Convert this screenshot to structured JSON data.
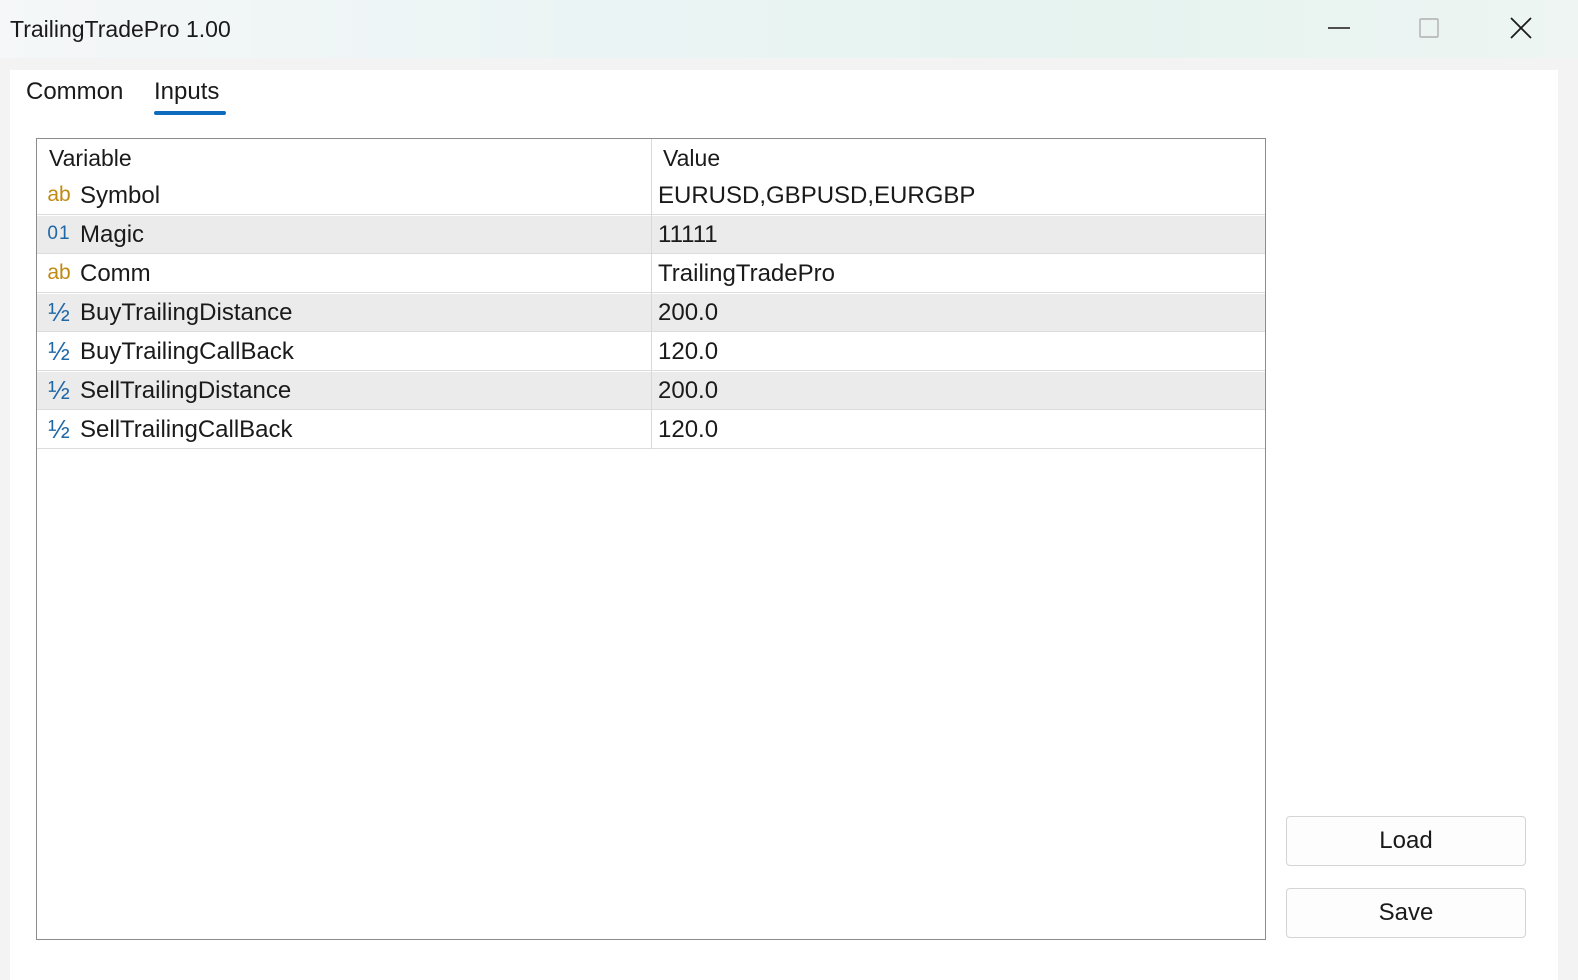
{
  "window": {
    "title": "TrailingTradePro 1.00",
    "controls": [
      "minimize-icon",
      "maximize-icon",
      "close-icon"
    ]
  },
  "tabs": [
    {
      "label": "Common",
      "active": false
    },
    {
      "label": "Inputs",
      "active": true
    }
  ],
  "accent_color": "#0f6cbd",
  "table": {
    "columns": [
      "Variable",
      "Value"
    ],
    "rows": [
      {
        "type_icon": "ab",
        "icon_name": "string-type-icon",
        "variable": "Symbol",
        "value": "EURUSD,GBPUSD,EURGBP"
      },
      {
        "type_icon": "01",
        "icon_name": "integer-type-icon",
        "variable": "Magic",
        "value": "11111"
      },
      {
        "type_icon": "ab",
        "icon_name": "string-type-icon",
        "variable": "Comm",
        "value": "TrailingTradePro"
      },
      {
        "type_icon": "½",
        "icon_name": "double-type-icon",
        "variable": "BuyTrailingDistance",
        "value": "200.0"
      },
      {
        "type_icon": "½",
        "icon_name": "double-type-icon",
        "variable": "BuyTrailingCallBack",
        "value": "120.0"
      },
      {
        "type_icon": "½",
        "icon_name": "double-type-icon",
        "variable": "SellTrailingDistance",
        "value": "200.0"
      },
      {
        "type_icon": "½",
        "icon_name": "double-type-icon",
        "variable": "SellTrailingCallBack",
        "value": "120.0"
      }
    ]
  },
  "buttons": {
    "load": "Load",
    "save": "Save"
  }
}
